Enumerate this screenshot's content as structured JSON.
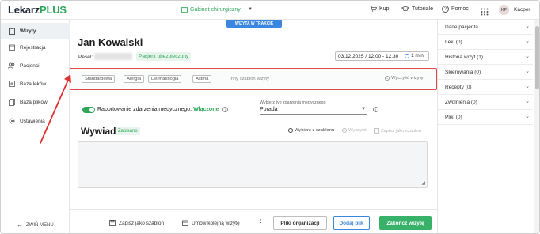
{
  "topbar": {
    "logo_main": "Lekarz",
    "logo_plus": "PLUS",
    "cabinet": "Gabinet chirurgiczny",
    "nav": {
      "buy": "Kup",
      "tutorials": "Tutoriale",
      "help": "Pomoc"
    },
    "avatar_initials": "KP",
    "username": "Kacper"
  },
  "sidebar": {
    "items": [
      {
        "label": "Wizyty",
        "icon": "clipboard-icon",
        "active": true
      },
      {
        "label": "Rejestracja",
        "icon": "calendar-icon",
        "active": false
      },
      {
        "label": "Pacjenci",
        "icon": "patients-icon",
        "active": false
      },
      {
        "label": "Baza leków",
        "icon": "medicine-icon",
        "active": false
      },
      {
        "label": "Baza plików",
        "icon": "files-icon",
        "active": false
      },
      {
        "label": "Ustawienia",
        "icon": "gear-icon",
        "active": false
      }
    ],
    "collapse_label": "ZWIŃ MENU"
  },
  "main": {
    "status": "WIZYTA W TRAKCIE",
    "patient_name": "Jan Kowalski",
    "pesel_label": "Pesel:",
    "insured_badge": "Pacjent ubezpieczony",
    "datetime": "03.12.2025 / 12:00 - 12:30",
    "duration": "1 min",
    "templates": {
      "chips": [
        "Standardowa",
        "Alergia",
        "Dermatologia",
        "Astma"
      ],
      "other": "Inny szablon wizyty",
      "clear": "Wyczyść wizytę"
    },
    "report": {
      "label": "Raportowanie zdarzenia medycznego:",
      "state": "Włączone"
    },
    "event_type": {
      "label": "Wybierz typ zdarzenia medycznego",
      "value": "Porada"
    },
    "section": {
      "title": "Wywiad",
      "saved_badge": "Zapisano",
      "choose_template": "Wybierz z szablonu",
      "clear": "Wyczyść",
      "save_template": "Zapisz jako szablon"
    },
    "footer": {
      "save_template": "Zapisz jako szablon",
      "next_visit": "Umów kolejną wizytę",
      "org_files": "Pliki organizacji",
      "add_file": "Dodaj plik",
      "finish": "Zakończ wizytę"
    }
  },
  "rightpanel": {
    "items": [
      "Dane pacjenta",
      "Leki  (0)",
      "Historia wizyt (1)",
      "Skierowania (0)",
      "Recepty (0)",
      "Zwolnienia (0)",
      "Pliki  (0)"
    ]
  },
  "colors": {
    "brand_green": "#2fa55a",
    "accent_blue": "#3a86e0",
    "highlight_red": "#e04848"
  }
}
